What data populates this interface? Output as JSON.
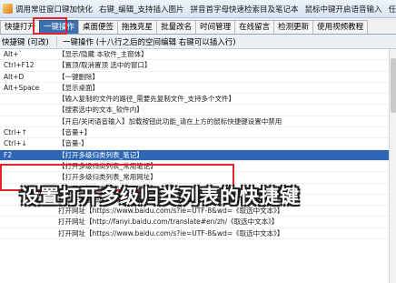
{
  "titlebar": {
    "items": [
      "调用常驻窗口键加快化",
      "右键_编辑_支持插入图片",
      "拼音首字母快速检索目及笔记本",
      "鼠标中键开启语音输入",
      "任务栏滚动修改音量"
    ]
  },
  "tabs": [
    {
      "label": "快捷打开",
      "active": false
    },
    {
      "label": "一键操作",
      "active": true
    },
    {
      "label": "桌面便签",
      "active": false
    },
    {
      "label": "拖拽克星",
      "active": false
    },
    {
      "label": "批量改名",
      "active": false
    },
    {
      "label": "时间管理",
      "active": false
    },
    {
      "label": "在线留言",
      "active": false
    },
    {
      "label": "检测更新",
      "active": false
    },
    {
      "label": "使用视频教程",
      "active": false
    }
  ],
  "grid": {
    "header_key": "快捷键 (可改)",
    "header_action": "一键操作 (十八行之后的空间编辑 右键可以插入行)",
    "rows": [
      {
        "key": "Alt+`",
        "action": "【显示/隐藏 本软件_主窗体】",
        "selected": false
      },
      {
        "key": "Ctrl+F12",
        "action": "【置顶/取消置顶 选中的窗口】",
        "selected": false
      },
      {
        "key": "Alt+D",
        "action": "【一键删除】",
        "selected": false
      },
      {
        "key": "Alt+Space",
        "action": "【显示桌面】",
        "selected": false
      },
      {
        "key": "",
        "action": "【输入复制的文件的路径_需要先复制文件_支持多个文件】",
        "selected": false
      },
      {
        "key": "",
        "action": "【搜索选中的文本_软件内】",
        "selected": false
      },
      {
        "key": "",
        "action": "【开启/关闭语音输入】加载按钮此功能_请在上方的鼠标快捷键设置中禁用",
        "selected": false
      },
      {
        "key": "Ctrl+↑",
        "action": "【音量+】",
        "selected": false
      },
      {
        "key": "Ctrl+↓",
        "action": "【音量-】",
        "selected": false
      },
      {
        "key": "F2",
        "action": "【打开多级归类列表_笔记】",
        "selected": true
      },
      {
        "key": "",
        "action": "【打开多级归类列表_常用笔记】",
        "selected": false
      },
      {
        "key": "",
        "action": "【打开多级归类列表_常用网址】",
        "selected": false
      },
      {
        "key": "",
        "action": "【打开多级归类列表_常用网址】",
        "selected": false
      },
      {
        "key": "",
        "action": "【打开多级归类列表_常用网址】",
        "selected": false
      },
      {
        "key": "",
        "action": "打开网址【https://www.baidu.com/s?ie=UTF-8&wd=《取选中文本》】",
        "selected": false
      },
      {
        "key": "",
        "action": "打开网址【http://fanyi.baidu.com/translate#en/zh/《取选中文本》】",
        "selected": false
      },
      {
        "key": "",
        "action": "打开网址【https://www.baidu.com/s?ie=UTF-8&wd=《取选中文本》】",
        "selected": false
      }
    ]
  },
  "caption": "设置打开多级归类列表的快捷键"
}
